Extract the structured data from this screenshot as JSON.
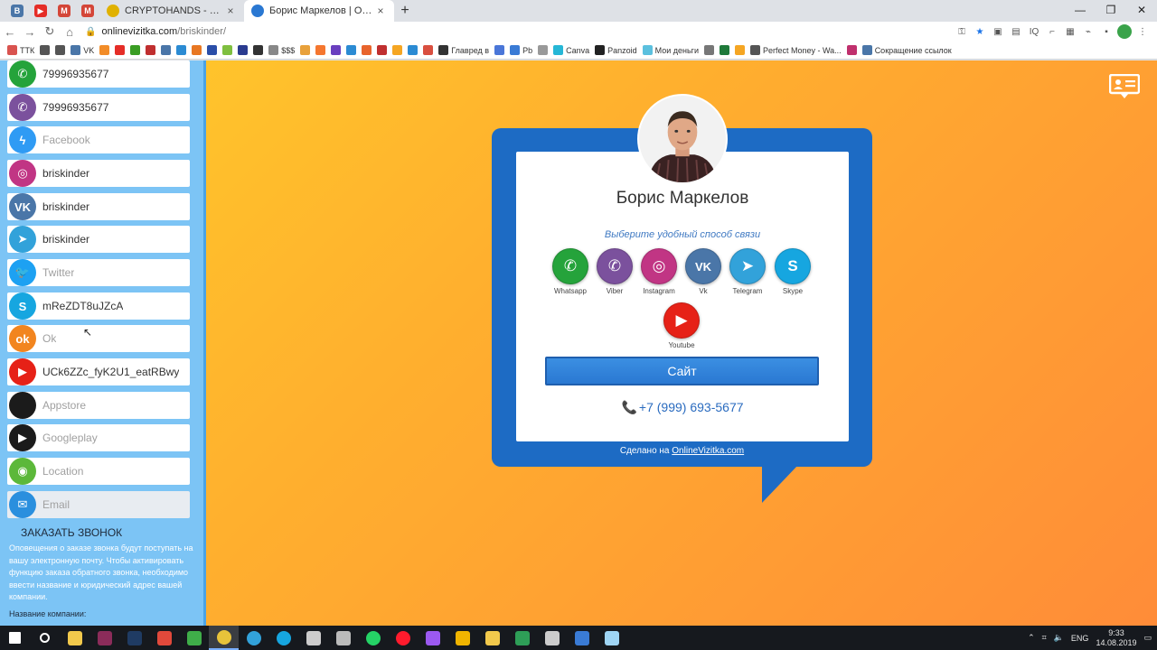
{
  "browser": {
    "pinned_tabs": [
      {
        "icon": "vk-icon",
        "glyph": "В",
        "color": "#4a76a8"
      },
      {
        "icon": "youtube-icon",
        "glyph": "▶",
        "color": "#e52d27"
      },
      {
        "icon": "gmail-icon",
        "glyph": "M",
        "color": "#d44638"
      },
      {
        "icon": "gmail-icon",
        "glyph": "M",
        "color": "#d44638"
      }
    ],
    "tabs": [
      {
        "title": "CRYPTOHANDS - Самый прост",
        "active": false,
        "favicon_color": "#e0b100"
      },
      {
        "title": "Борис Маркелов | Онлайн-Виз",
        "active": true,
        "favicon_color": "#2a78d2"
      }
    ],
    "url_host": "onlinevizitka.com",
    "url_path": "/briskinder/",
    "bookmarks": [
      {
        "label": "ТТК",
        "color": "#d9534f"
      },
      {
        "label": "",
        "color": "#555"
      },
      {
        "label": "",
        "color": "#555"
      },
      {
        "label": "VK",
        "color": "#4a76a8"
      },
      {
        "label": "",
        "color": "#f28c28"
      },
      {
        "label": "",
        "color": "#e52d27"
      },
      {
        "label": "",
        "color": "#3a9d23"
      },
      {
        "label": "",
        "color": "#c02f2f"
      },
      {
        "label": "",
        "color": "#4a76a8"
      },
      {
        "label": "",
        "color": "#2b8bd3"
      },
      {
        "label": "",
        "color": "#e87722"
      },
      {
        "label": "",
        "color": "#2a4ea8"
      },
      {
        "label": "",
        "color": "#7fbf3f"
      },
      {
        "label": "",
        "color": "#2a3b8f"
      },
      {
        "label": "",
        "color": "#333"
      },
      {
        "label": "$$$",
        "color": "#888"
      },
      {
        "label": "",
        "color": "#e8a13b"
      },
      {
        "label": "",
        "color": "#f5772f"
      },
      {
        "label": "",
        "color": "#6a3fbf"
      },
      {
        "label": "",
        "color": "#2b8bd3"
      },
      {
        "label": "",
        "color": "#e8642c"
      },
      {
        "label": "",
        "color": "#c02f2f"
      },
      {
        "label": "",
        "color": "#f5a623"
      },
      {
        "label": "",
        "color": "#2b8bd3"
      },
      {
        "label": "",
        "color": "#d94f3f"
      },
      {
        "label": "Главред в",
        "color": "#333"
      },
      {
        "label": "",
        "color": "#4a76d8"
      },
      {
        "label": "Pb",
        "color": "#3a7bd5"
      },
      {
        "label": "",
        "color": "#999"
      },
      {
        "label": "Canva",
        "color": "#26b7d6"
      },
      {
        "label": "Panzoid",
        "color": "#222"
      },
      {
        "label": "Мои деньги",
        "color": "#5bc0de"
      },
      {
        "label": "",
        "color": "#777"
      },
      {
        "label": "",
        "color": "#1f7a3a"
      },
      {
        "label": "",
        "color": "#f5a623"
      },
      {
        "label": "Perfect Money - Wa...",
        "color": "#555"
      },
      {
        "label": "",
        "color": "#c0306d"
      },
      {
        "label": "Сокращение ссылок",
        "color": "#4a76a8"
      }
    ],
    "window_controls": {
      "minimize": "—",
      "restore": "❐",
      "close": "✕"
    }
  },
  "panel": {
    "rows": [
      {
        "icon": "whatsapp-icon",
        "glyph": "✆",
        "color": "#25a33b",
        "value": "79996935677",
        "placeholder": false
      },
      {
        "icon": "viber-icon",
        "glyph": "✆",
        "color": "#7b519d",
        "value": "79996935677",
        "placeholder": false
      },
      {
        "icon": "messenger-icon",
        "glyph": "ϟ",
        "color": "#2f9bf4",
        "value": "Facebook",
        "placeholder": true
      },
      {
        "icon": "instagram-icon",
        "glyph": "◎",
        "color": "#c13584",
        "value": "briskinder",
        "placeholder": false
      },
      {
        "icon": "vk-icon",
        "glyph": "VK",
        "color": "#4a76a8",
        "value": "briskinder",
        "placeholder": false
      },
      {
        "icon": "telegram-icon",
        "glyph": "➤",
        "color": "#32a2da",
        "value": "briskinder",
        "placeholder": false
      },
      {
        "icon": "twitter-icon",
        "glyph": "🐦",
        "color": "#1da1f2",
        "value": "Twitter",
        "placeholder": true
      },
      {
        "icon": "skype-icon",
        "glyph": "S",
        "color": "#16a6e0",
        "value": "mReZDT8uJZcA",
        "placeholder": false
      },
      {
        "icon": "ok-icon",
        "glyph": "ok",
        "color": "#f2851f",
        "value": "Ok",
        "placeholder": true
      },
      {
        "icon": "youtube-icon",
        "glyph": "▶",
        "color": "#e62117",
        "value": "UCk6ZZc_fyK2U1_eatRBwy",
        "placeholder": false
      },
      {
        "icon": "apple-icon",
        "glyph": "",
        "color": "#1b1b1b",
        "value": "Appstore",
        "placeholder": true
      },
      {
        "icon": "googleplay-icon",
        "glyph": "▶",
        "color": "#1b1b1b",
        "value": "Googleplay",
        "placeholder": true
      },
      {
        "icon": "location-icon",
        "glyph": "◉",
        "color": "#5cb83a",
        "value": "Location",
        "placeholder": true
      },
      {
        "icon": "email-icon",
        "glyph": "✉",
        "color": "#2a8fde",
        "value": "Email",
        "placeholder": true
      }
    ],
    "order_call_title": "ЗАКАЗАТЬ ЗВОНОК",
    "order_call_note": "Оповещения о заказе звонка будут поступать на вашу электронную почту. Чтобы активировать функцию заказа обратного звонка, необходимо ввести название и юридический адрес вашей компании.",
    "company_label": "Название компании:"
  },
  "card": {
    "name": "Борис Маркелов",
    "choose_text": "Выберите удобный способ связи",
    "socials": [
      {
        "icon": "whatsapp-icon",
        "label": "Whatsapp",
        "color": "#25a33b",
        "glyph": "✆"
      },
      {
        "icon": "viber-icon",
        "label": "Viber",
        "color": "#7b519d",
        "glyph": "✆"
      },
      {
        "icon": "instagram-icon",
        "label": "Instagram",
        "color": "#c13584",
        "glyph": "◎"
      },
      {
        "icon": "vk-icon",
        "label": "Vk",
        "color": "#4a76a8",
        "glyph": "VK"
      },
      {
        "icon": "telegram-icon",
        "label": "Telegram",
        "color": "#32a2da",
        "glyph": "➤"
      },
      {
        "icon": "skype-icon",
        "label": "Skype",
        "color": "#16a6e0",
        "glyph": "S"
      },
      {
        "icon": "youtube-icon",
        "label": "Youtube",
        "color": "#e62117",
        "glyph": "▶"
      }
    ],
    "site_button": "Сайт",
    "phone": "+7 (999) 693-5677",
    "made_by_prefix": "Сделано на ",
    "made_by_link": "OnlineVizitka.com"
  },
  "taskbar": {
    "apps": [
      {
        "icon": "windows-start-icon",
        "color": "#ffffff"
      },
      {
        "icon": "search-icon",
        "color": "#ffffff"
      },
      {
        "icon": "file-explorer-icon",
        "color": "#f2c94c"
      },
      {
        "icon": "app-icon",
        "color": "#8b2c5a"
      },
      {
        "icon": "photoshop-icon",
        "color": "#1f3b63"
      },
      {
        "icon": "app-icon",
        "color": "#e1493b"
      },
      {
        "icon": "app-icon",
        "color": "#3fae49"
      },
      {
        "icon": "chrome-icon",
        "color": "#e8c33a",
        "active": true
      },
      {
        "icon": "telegram-icon",
        "color": "#32a2da"
      },
      {
        "icon": "skype-icon",
        "color": "#16a6e0"
      },
      {
        "icon": "calculator-icon",
        "color": "#cccccc"
      },
      {
        "icon": "app-icon",
        "color": "#bbbbbb"
      },
      {
        "icon": "whatsapp-icon",
        "color": "#25d366"
      },
      {
        "icon": "opera-icon",
        "color": "#ff1b2d"
      },
      {
        "icon": "app-icon",
        "color": "#9b59f0"
      },
      {
        "icon": "app-icon",
        "color": "#f0b400"
      },
      {
        "icon": "app-icon",
        "color": "#f2c94c"
      },
      {
        "icon": "app-icon",
        "color": "#2e9e57"
      },
      {
        "icon": "app-icon",
        "color": "#cccccc"
      },
      {
        "icon": "app-icon",
        "color": "#3a7bd5"
      },
      {
        "icon": "app-icon",
        "color": "#9fd5f5"
      }
    ],
    "lang": "ENG",
    "time": "9:33",
    "date": "14.08.2019"
  }
}
